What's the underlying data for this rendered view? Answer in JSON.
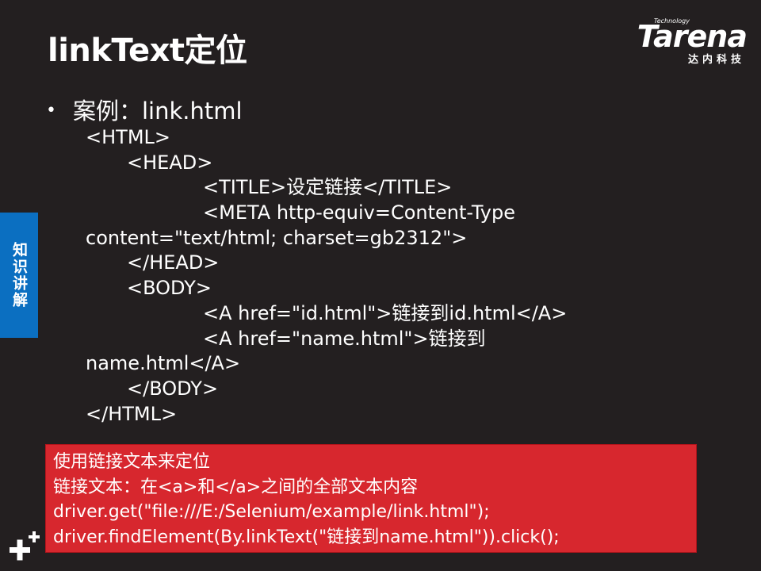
{
  "slide": {
    "title": "linkText定位",
    "logo": {
      "technology": "Technology",
      "brand": "Tarena",
      "subtitle": "达内科技"
    },
    "side_tab": "知识讲解",
    "bullet": "案例：link.html",
    "code_lines": [
      "<HTML>",
      "<HEAD>",
      "<TITLE>设定链接</TITLE>",
      "<META http-equiv=Content-Type",
      "content=\"text/html; charset=gb2312\">",
      "</HEAD>",
      "<BODY>",
      "<A href=\"id.html\">链接到id.html</A>",
      "<A href=\"name.html\">链接到",
      "name.html</A>",
      "</BODY>",
      "</HTML>"
    ],
    "note_lines": [
      "使用链接文本来定位",
      "链接文本：在<a>和</a>之间的全部文本内容",
      "driver.get(\"file:///E:/Selenium/example/link.html\");",
      "driver.findElement(By.linkText(\"链接到name.html\")).click();"
    ],
    "colors": {
      "background": "#231f20",
      "side_tab": "#0b6fc1",
      "note_box": "#d7272e",
      "text": "#ffffff"
    }
  }
}
